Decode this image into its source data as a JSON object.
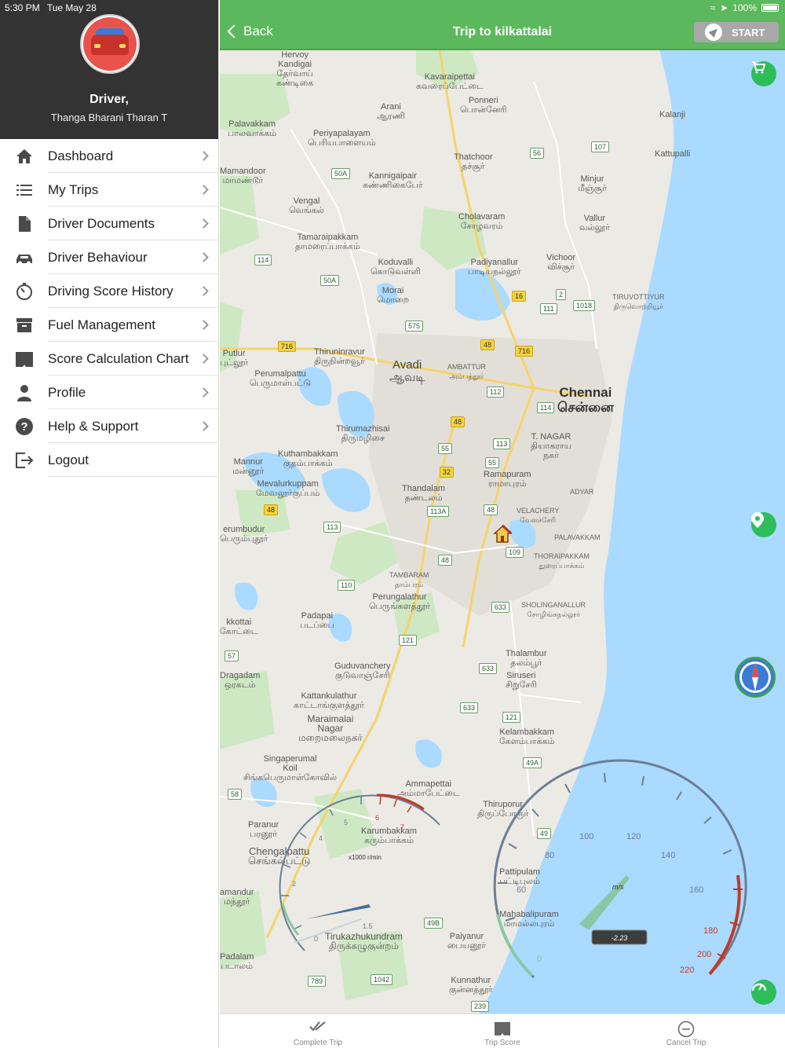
{
  "status_bar": {
    "time": "5:30 PM",
    "date": "Tue May 28",
    "battery": "100%"
  },
  "profile": {
    "role": "Driver,",
    "name": "Thanga Bharani Tharan T"
  },
  "menu": [
    {
      "label": "Dashboard",
      "icon": "home-icon"
    },
    {
      "label": "My Trips",
      "icon": "list-icon"
    },
    {
      "label": "Driver Documents",
      "icon": "document-icon"
    },
    {
      "label": "Driver Behaviour",
      "icon": "car-icon"
    },
    {
      "label": "Driving Score History",
      "icon": "timer-icon"
    },
    {
      "label": "Fuel Management",
      "icon": "archive-icon"
    },
    {
      "label": "Score Calculation Chart",
      "icon": "book-icon"
    },
    {
      "label": "Profile",
      "icon": "person-icon"
    },
    {
      "label": "Help & Support",
      "icon": "help-icon"
    },
    {
      "label": "Logout",
      "icon": "logout-icon"
    }
  ],
  "navbar": {
    "back_label": "Back",
    "title": "Trip to kilkattalai",
    "start_label": "START"
  },
  "map": {
    "places": [
      "Hervoy",
      "Kandigai",
      "தேர்வாய்",
      "கண்டிகை",
      "Kavaraipettai",
      "கவரைப்பேட்டை",
      "Ponneri",
      "பொன்னேரி",
      "Arani",
      "ஆரணி",
      "Kalanji",
      "Palavakkam",
      "பாலவாக்கம்",
      "Periyapalayam",
      "பெரியபாளையம்",
      "Thatchoor",
      "தச்சூர்",
      "Kattupalli",
      "Mamandoor",
      "மாமண்டூர்",
      "Kannigaipair",
      "கண்ணிகைபேர்",
      "Minjur",
      "மீஞ்சூர்",
      "Vengal",
      "வெங்கல்",
      "Cholavaram",
      "சோழவரம்",
      "Vallur",
      "வல்லூர்",
      "Tamaraipakkam",
      "தாமரைப்பாக்கம்",
      "Koduvalli",
      "கொடுவள்ளி",
      "Padiyanallur",
      "பாடியநல்லூர்",
      "Vichoor",
      "விச்சூர்",
      "TIRUVOTTIYUR",
      "திருவொற்றியூர்",
      "Morai",
      "மொறை",
      "Thiruninravur",
      "திருநின்றவூர்",
      "Putlur",
      "புட்லூர்",
      "Avadi",
      "ஆவடி",
      "AMBATTUR",
      "அம்பத்தூர்",
      "Perumalpattu",
      "பெருமாள்பட்டு",
      "Chennai",
      "சென்னை",
      "Thirumazhisai",
      "திருமழிசை",
      "T. NAGAR",
      "தியாகராய",
      "நகர்",
      "Mannur",
      "மன்னூர்",
      "Kuthambakkam",
      "குதம்பாக்கம்",
      "Mevalurkuppam",
      "மேவலூர்குப்பம்",
      "Thandalam",
      "தண்டலம்",
      "Ramapuram",
      "ராமாபுரம்",
      "ADYAR",
      "VELACHERY",
      "வேளச்சேரி",
      "erumbudur",
      "பெரும்புதூர்",
      "PALAVAKKAM",
      "THORAIPAKKAM",
      "துரைப்பாக்கம்",
      "TAMBARAM",
      "தாம்பரம்",
      "Perungalathur",
      "பெருங்களத்தூர்",
      "SHOLINGANALLUR",
      "சோழிங்கநல்லூர்",
      "kkottai",
      "கோட்டை",
      "Padapai",
      "படப்பை",
      "Thalambur",
      "தலம்பூர்",
      "Siruseri",
      "சிறுசேரி",
      "Guduvanchery",
      "குடுவாஞ்சேரி",
      "Dragadam",
      "ஒரகடம்",
      "Kattankulathur",
      "காட்டாங்குளத்தூர்",
      "Maraimalai",
      "Nagar",
      "மறைமலைநகர்",
      "Kelambakkam",
      "கேளம்பாக்கம்",
      "Singaperumal",
      "Koil",
      "சிங்கபெருமாள்கோவில்",
      "Ammapettai",
      "அம்மாபேட்டை",
      "Paranur",
      "பரனூர்",
      "Chengalpattu",
      "செங்கல்பட்டு",
      "Karumbakkam",
      "கரும்பாக்கம்",
      "Thiruporur",
      "திருப்போரூர்",
      "amandur",
      "மந்தூர்",
      "Pattipulam",
      "பட்டிபுலம்",
      "Mahabalipuram",
      "மாமல்லபுரம்",
      "Tirukazhukundram",
      "திருக்கழுகுன்றம்",
      "Paiyanur",
      "பையனூர்",
      "Padalam",
      "படாலம்",
      "Kunnathur",
      "குன்னத்தூர்"
    ],
    "route_shields": [
      "107",
      "56",
      "50A",
      "114",
      "50A",
      "16",
      "2",
      "1018",
      "111",
      "575",
      "716",
      "48",
      "716",
      "112",
      "114",
      "48",
      "113",
      "55",
      "55",
      "32",
      "113A",
      "48",
      "48",
      "113",
      "109",
      "48",
      "110",
      "633",
      "121",
      "57",
      "633",
      "633",
      "121",
      "49A",
      "58",
      "49",
      "49B",
      "789",
      "1042",
      "239"
    ]
  },
  "rpm_gauge": {
    "unit": "x1000 r/min",
    "ticks": [
      "0",
      "1.5",
      "2",
      "4",
      "5",
      "6",
      "7"
    ]
  },
  "speed_gauge": {
    "unit": "m/s",
    "readout": "-2.23",
    "ticks": [
      "0",
      "60",
      "80",
      "100",
      "120",
      "140",
      "160",
      "180",
      "200",
      "220"
    ]
  },
  "tabs": [
    {
      "label": "Complete Trip",
      "icon": "check-icon"
    },
    {
      "label": "Trip Score",
      "icon": "book-icon"
    },
    {
      "label": "Cancel Trip",
      "icon": "minus-circle-icon"
    }
  ],
  "colors": {
    "nav_green": "#5cb85c",
    "profile_bg": "#333333",
    "fab_green": "#2ebd5b",
    "water": "#aadaff"
  }
}
